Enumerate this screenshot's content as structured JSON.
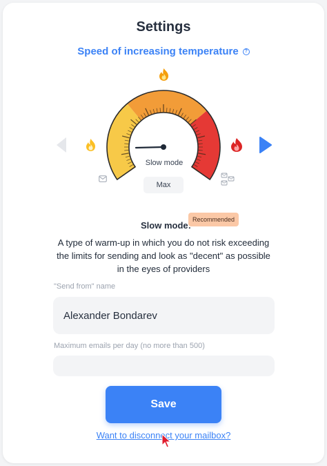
{
  "page": {
    "title": "Settings",
    "subtitle": "Speed of increasing temperature",
    "help_icon": "question-circle-icon"
  },
  "gauge": {
    "mode_text": "Slow mode",
    "max_label": "Max",
    "level": 0.0,
    "colors": {
      "low": "#f7c948",
      "mid": "#f29c38",
      "high": "#e53935",
      "border": "#2b2b2b"
    },
    "icons": [
      "flame-top-icon",
      "flame-left-icon",
      "flame-right-icon",
      "envelope-icon",
      "envelopes-stack-icon",
      "arrow-left-icon",
      "arrow-right-icon"
    ]
  },
  "mode_info": {
    "label": "Slow mode:",
    "badge": "Recommended",
    "description": "A type of warm-up in which you do not risk exceeding the limits for sending and look as \"decent\" as possible in the eyes of providers"
  },
  "form": {
    "send_from_label": "\"Send from\" name",
    "send_from_value": "Alexander Bondarev",
    "max_emails_label": "Maximum emails per day (no more than 500)",
    "max_emails_value": "",
    "save_label": "Save",
    "disconnect_label": "Want to disconnect your mailbox?"
  },
  "colors": {
    "accent": "#3b82f6"
  }
}
